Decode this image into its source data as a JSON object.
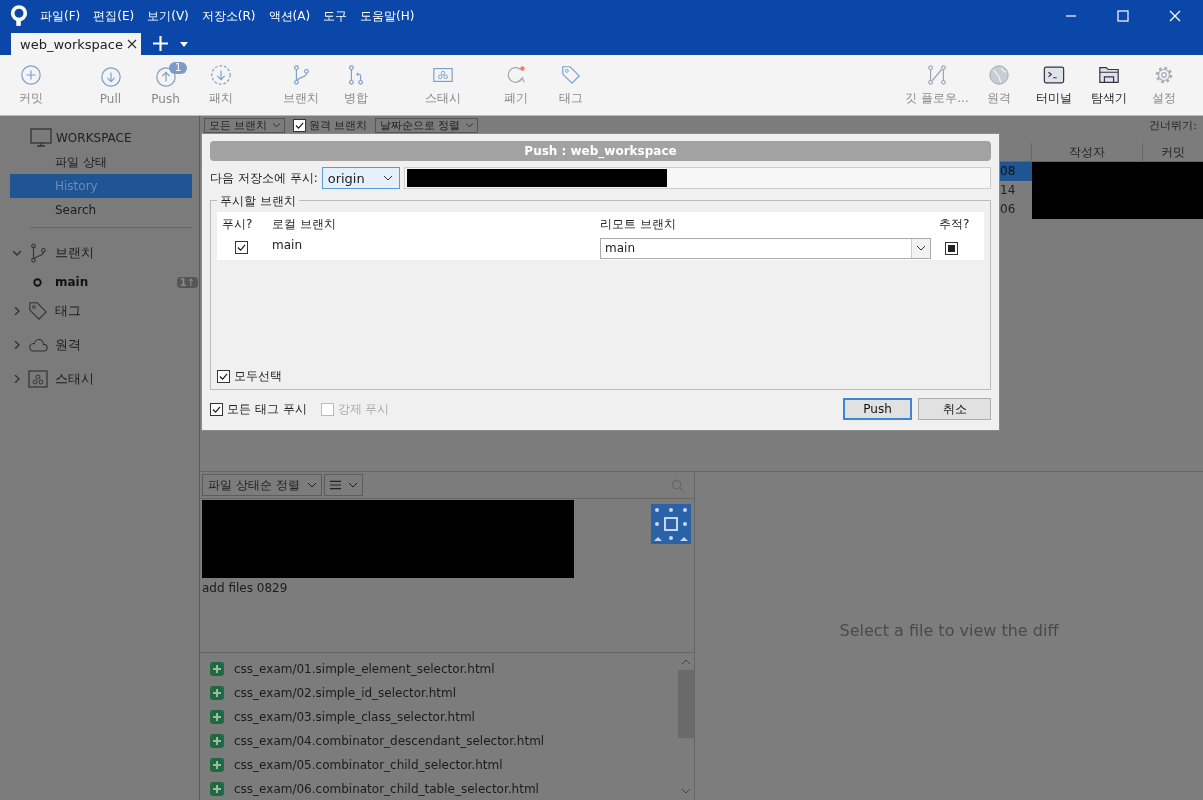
{
  "menu": [
    "파일(F)",
    "편집(E)",
    "보기(V)",
    "저장소(R)",
    "액션(A)",
    "도구",
    "도움말(H)"
  ],
  "tabs": [
    {
      "label": "web_workspace",
      "selected": true
    }
  ],
  "toolbar": {
    "left": [
      {
        "label": "커밋",
        "kind": "commit",
        "disabled": true
      },
      {
        "label": "Pull",
        "kind": "pull",
        "disabled": true
      },
      {
        "label": "Push",
        "kind": "push",
        "disabled": true,
        "badge": "1"
      },
      {
        "label": "패치",
        "kind": "fetch",
        "disabled": true
      },
      {
        "label": "브랜치",
        "kind": "branch",
        "disabled": true
      },
      {
        "label": "병합",
        "kind": "merge",
        "disabled": true
      },
      {
        "label": "스태시",
        "kind": "stash",
        "disabled": true
      },
      {
        "label": "폐기",
        "kind": "discard",
        "disabled": true
      },
      {
        "label": "태그",
        "kind": "tag",
        "disabled": true
      }
    ],
    "right": [
      {
        "label": "깃 플로우...",
        "kind": "gitflow",
        "disabled": true
      },
      {
        "label": "원격",
        "kind": "remote",
        "disabled": true
      },
      {
        "label": "터미널",
        "kind": "terminal",
        "disabled": false
      },
      {
        "label": "탐색기",
        "kind": "explorer",
        "disabled": false
      },
      {
        "label": "설정",
        "kind": "settings",
        "disabled": true
      }
    ]
  },
  "sidebar": {
    "workspace": "WORKSPACE",
    "items": [
      {
        "label": "파일 상태",
        "selected": false
      },
      {
        "label": "History",
        "selected": true
      },
      {
        "label": "Search",
        "selected": false
      }
    ],
    "groups": [
      {
        "label": "브랜치",
        "kind": "branch",
        "expanded": true,
        "children": [
          {
            "label": "main",
            "badge": "1↑"
          }
        ]
      },
      {
        "label": "태그",
        "kind": "tag",
        "expanded": false
      },
      {
        "label": "원격",
        "kind": "cloud",
        "expanded": false
      },
      {
        "label": "스태시",
        "kind": "stash",
        "expanded": false
      }
    ]
  },
  "history": {
    "filters": [
      {
        "kind": "dropdown",
        "label": "모든 브랜치"
      },
      {
        "kind": "checkbox",
        "label": "원격 브랜치",
        "checked": true
      },
      {
        "kind": "dropdown",
        "label": "날짜순으로 정렬"
      }
    ],
    "jump_label": "건너뛰기:",
    "columns": [
      "작성자",
      "커밋"
    ],
    "rows": [
      {
        "column_1": "08",
        "selected": true
      },
      {
        "column_1": "14",
        "selected": false
      },
      {
        "column_1": "06",
        "selected": false
      }
    ]
  },
  "dialog": {
    "title": "Push :  web_workspace",
    "remote_label": "다음 저장소에 푸시:",
    "remote": "origin",
    "branches_group": "푸시할 브랜치",
    "columns": [
      "푸시?",
      "로컬 브랜치",
      "리모트 브랜치",
      "추적?"
    ],
    "branches": [
      {
        "push": true,
        "local": "main",
        "remote": "main",
        "track": true
      }
    ],
    "select_all": {
      "label": "모두선택",
      "checked": true
    },
    "options": [
      {
        "label": "모든 태그 푸시",
        "checked": true,
        "disabled": false
      },
      {
        "label": "강제 푸시",
        "checked": false,
        "disabled": true
      }
    ],
    "buttons": [
      {
        "label": "Push",
        "default": true
      },
      {
        "label": "취소",
        "default": false
      }
    ]
  },
  "files": {
    "sort": "파일 상태순 정렬",
    "commit_message": "add files 0829",
    "items": [
      {
        "path": "css_exam/01.simple_element_selector.html",
        "kind": "added"
      },
      {
        "path": "css_exam/02.simple_id_selector.html",
        "kind": "added"
      },
      {
        "path": "css_exam/03.simple_class_selector.html",
        "kind": "added"
      },
      {
        "path": "css_exam/04.combinator_descendant_selector.html",
        "kind": "added"
      },
      {
        "path": "css_exam/05.combinator_child_selector.html",
        "kind": "added"
      },
      {
        "path": "css_exam/06.combinator_child_table_selector.html",
        "kind": "added"
      }
    ],
    "diff_placeholder": "Select a file to view the diff"
  }
}
